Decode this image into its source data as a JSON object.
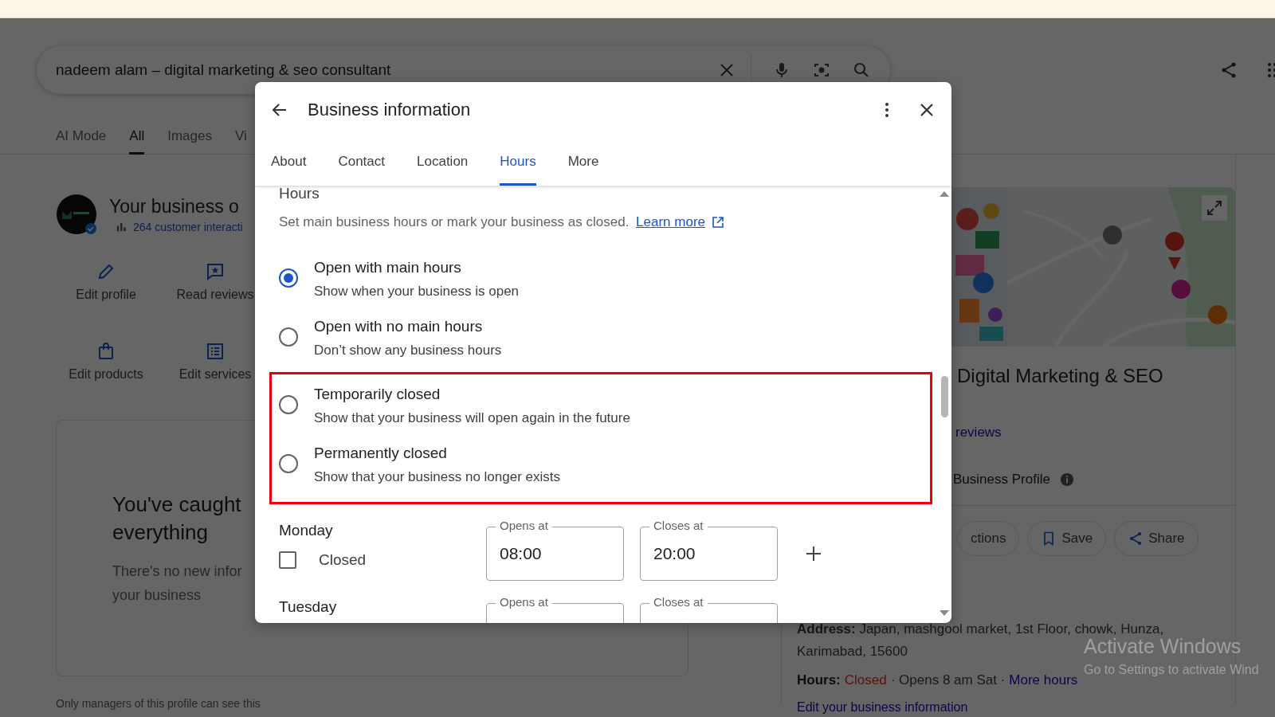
{
  "search": {
    "value": "nadeem alam – digital marketing & seo consultant"
  },
  "search_tabs": [
    {
      "label": "AI Mode",
      "selected": false
    },
    {
      "label": "All",
      "selected": true
    },
    {
      "label": "Images",
      "selected": false
    },
    {
      "label": "Vi",
      "selected": false
    }
  ],
  "business": {
    "title": "Your business o",
    "interactions": "264 customer interacti",
    "actions": [
      {
        "label": "Edit profile",
        "kind": "pencil"
      },
      {
        "label": "Read reviews",
        "kind": "review"
      },
      {
        "label": "Edit products",
        "kind": "bag"
      },
      {
        "label": "Edit services",
        "kind": "list"
      }
    ],
    "card": {
      "title": "You've caught everything",
      "text": "There's no new infor your business"
    },
    "footer": "Only managers of this profile can see this"
  },
  "panel": {
    "name": "Digital Marketing & SEO",
    "reviews": "reviews",
    "profile": "Business Profile",
    "buttons": [
      {
        "label": "ctions",
        "kind": "none"
      },
      {
        "label": "Save",
        "kind": "bookmark"
      },
      {
        "label": "Share",
        "kind": "share"
      }
    ],
    "address_lines": [
      "**Address:** Japan, mashgool market, 1st Floor, chowk, Hunza,",
      "Karimabad, 15600"
    ],
    "hours": {
      "label": "Hours:",
      "status": "Closed",
      "detail": "· Opens 8 am Sat ·",
      "link": "More hours"
    },
    "edit_link": "Edit your business information"
  },
  "dialog": {
    "title": "Business information",
    "tabs": [
      {
        "label": "About",
        "selected": false
      },
      {
        "label": "Contact",
        "selected": false
      },
      {
        "label": "Location",
        "selected": false
      },
      {
        "label": "Hours",
        "selected": true
      },
      {
        "label": "More",
        "selected": false
      }
    ],
    "section_title": "Hours",
    "description": "Set main business hours or mark your business as closed.",
    "learn_more": "Learn more",
    "options": [
      {
        "title": "Open with main hours",
        "subtitle": "Show when your business is open",
        "selected": true,
        "highlighted": false
      },
      {
        "title": "Open with no main hours",
        "subtitle": "Don’t show any business hours",
        "selected": false,
        "highlighted": false
      },
      {
        "title": "Temporarily closed",
        "subtitle": "Show that your business will open again in the future",
        "selected": false,
        "highlighted": true
      },
      {
        "title": "Permanently closed",
        "subtitle": "Show that your business no longer exists",
        "selected": false,
        "highlighted": true
      }
    ],
    "days": [
      {
        "day": "Monday",
        "closed_label": "Closed",
        "closed": false,
        "opens_label": "Opens at",
        "opens": "08:00",
        "closes_label": "Closes at",
        "closes": "20:00"
      },
      {
        "day": "Tuesday",
        "opens_label": "Opens at",
        "closes_label": "Closes at"
      }
    ]
  },
  "os_notice": {
    "title": "Activate Windows",
    "text": "Go to Settings to activate Wind"
  }
}
